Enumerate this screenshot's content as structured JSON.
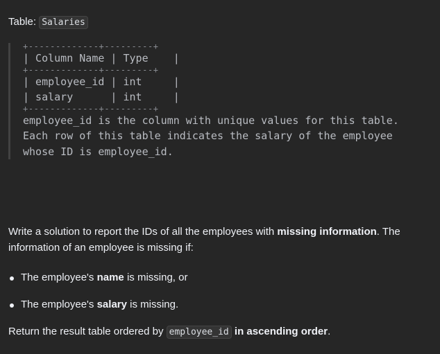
{
  "table_label": "Table:",
  "table_name": "Salaries",
  "schema_block": {
    "border_top": "+-------------+---------+",
    "header": "| Column Name | Type    |",
    "border_mid": "+-------------+---------+",
    "rows": [
      "| employee_id | int     |",
      "| salary      | int     |"
    ],
    "border_bottom": "+-------------+---------+",
    "notes": [
      "employee_id is the column with unique values for this table.",
      "Each row of this table indicates the salary of the employee",
      "whose ID is employee_id."
    ]
  },
  "description": {
    "before": "Write a solution to report the IDs of all the employees with ",
    "bold": "missing information",
    "after": ". The information of an employee is missing if:"
  },
  "conditions": [
    {
      "before": "The employee's ",
      "bold": "name",
      "after": " is missing, or"
    },
    {
      "before": "The employee's ",
      "bold": "salary",
      "after": " is missing."
    }
  ],
  "return_line": {
    "before": "Return the result table ordered by ",
    "code": "employee_id",
    "bold": " in ascending order",
    "after": "."
  }
}
